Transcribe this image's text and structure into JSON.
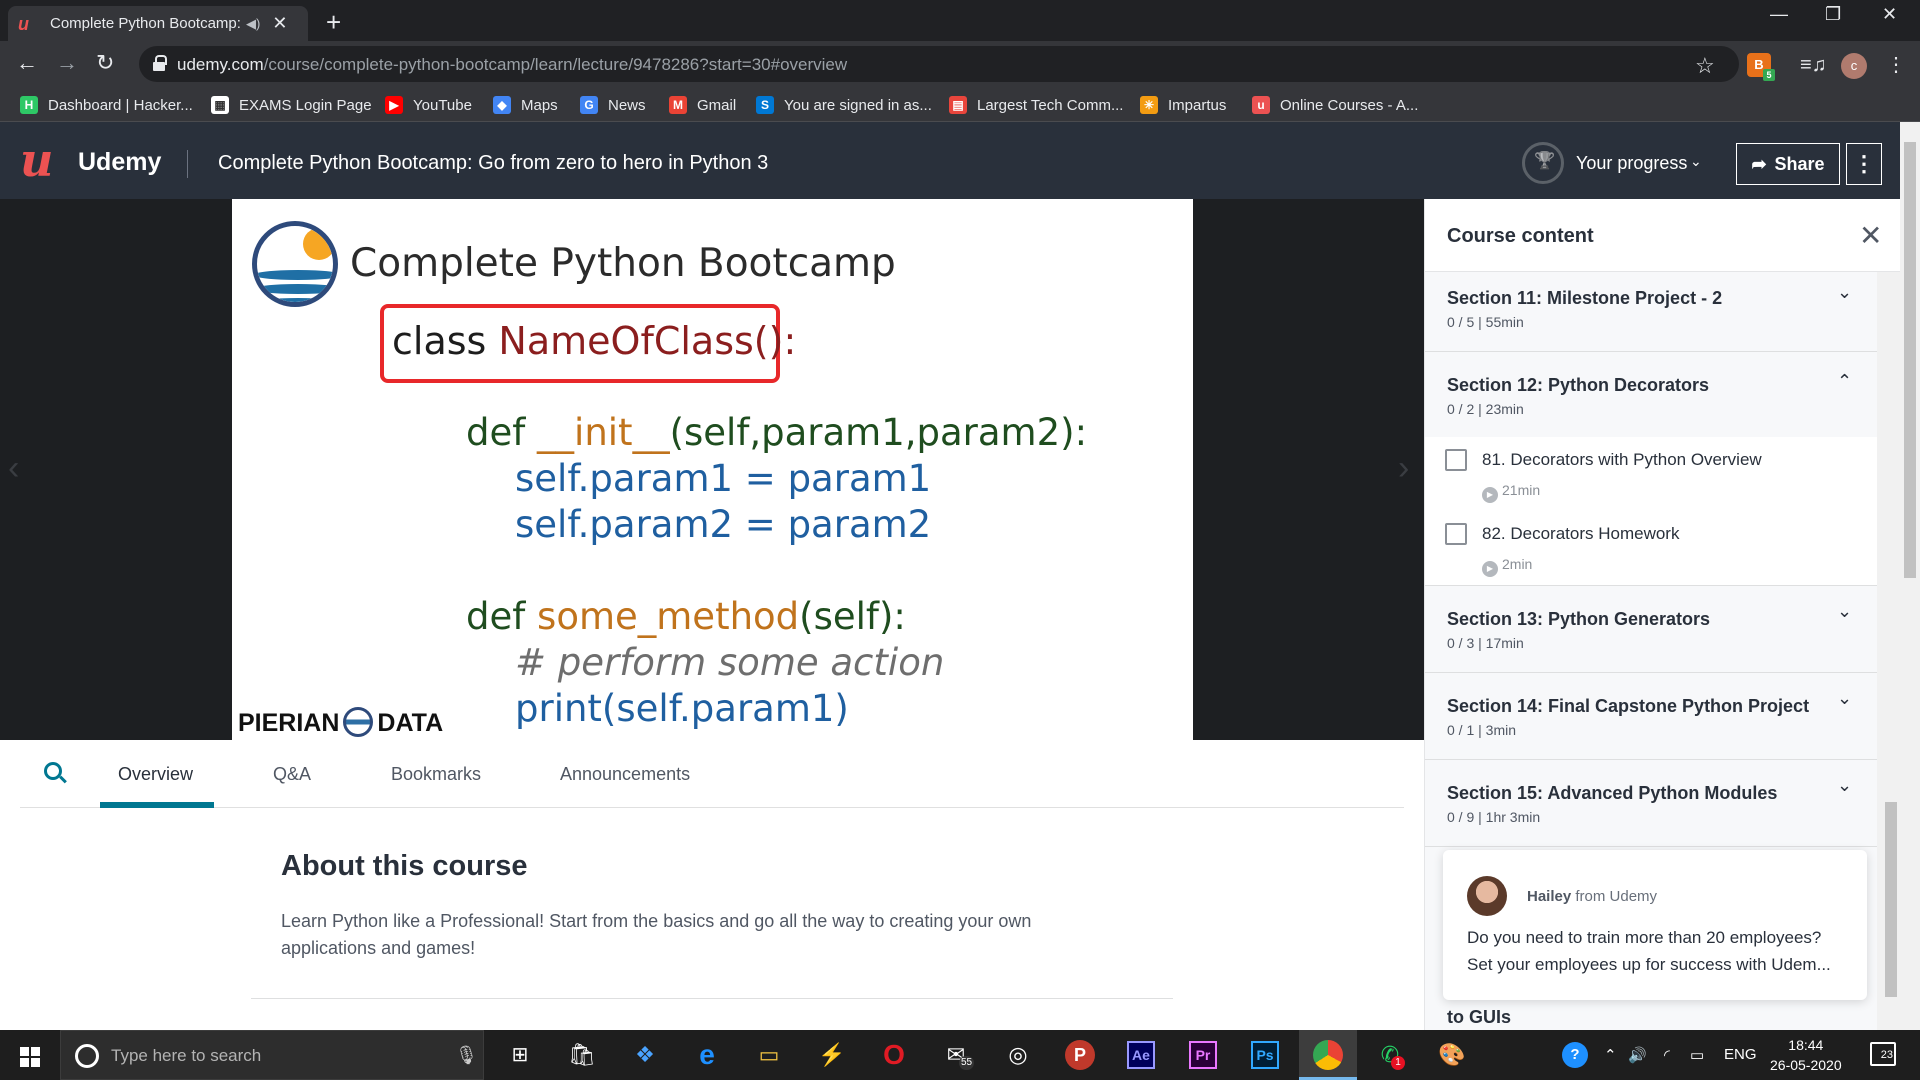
{
  "browser": {
    "tab_title": "Complete Python Bootcamp: Go from zero to hero in Python 3",
    "url_host": "udemy.com",
    "url_path": "/course/complete-python-bootcamp/learn/lecture/9478286?start=30#overview",
    "profile_initial": "c",
    "extension_badge": "5",
    "bookmarks": [
      {
        "label": "Dashboard | Hacker...",
        "icon": "hackerrank-icon",
        "color": "#2ec866",
        "glyph": "H"
      },
      {
        "label": "EXAMS Login Page",
        "icon": "exams-icon",
        "color": "#ffffff",
        "glyph": "▦"
      },
      {
        "label": "YouTube",
        "icon": "youtube-icon",
        "color": "#ff0000",
        "glyph": "▶"
      },
      {
        "label": "Maps",
        "icon": "maps-icon",
        "color": "#4285f4",
        "glyph": "◆"
      },
      {
        "label": "News",
        "icon": "news-icon",
        "color": "#4285f4",
        "glyph": "G"
      },
      {
        "label": "Gmail",
        "icon": "gmail-icon",
        "color": "#ea4335",
        "glyph": "M"
      },
      {
        "label": "You are signed in as...",
        "icon": "signin-icon",
        "color": "#0078d4",
        "glyph": "S"
      },
      {
        "label": "Largest Tech Comm...",
        "icon": "tech-community-icon",
        "color": "#e8453c",
        "glyph": "▤"
      },
      {
        "label": "Impartus",
        "icon": "impartus-icon",
        "color": "#f39c12",
        "glyph": "✳"
      },
      {
        "label": "Online Courses - A...",
        "icon": "udemy-icon",
        "color": "#ec5252",
        "glyph": "u"
      }
    ]
  },
  "header": {
    "logo_text": "Udemy",
    "course_title": "Complete Python Bootcamp: Go from zero to hero in Python 3",
    "progress_label": "Your progress",
    "share_label": "Share"
  },
  "slide": {
    "title": "Complete Python Bootcamp",
    "class_line": "class NameOfClass():",
    "code": {
      "def1_kw": "def ",
      "def1_fn": "__init__",
      "def1_args": "(self,param1,param2):",
      "line2": "self.param1 = param1",
      "line3": "self.param2 = param2",
      "def2_kw": "def ",
      "def2_fn": "some_method",
      "def2_args": "(self):",
      "comment": "# perform some action",
      "print_line": "print(self.param1)"
    },
    "brand_left": "PIERIAN",
    "brand_right": "DATA"
  },
  "content_tabs": {
    "items": [
      "Overview",
      "Q&A",
      "Bookmarks",
      "Announcements"
    ],
    "active": "Overview"
  },
  "about": {
    "title": "About this course",
    "description": "Learn Python like a Professional! Start from the basics and go all the way to creating your own applications and games!"
  },
  "sidebar": {
    "title": "Course content",
    "sections": [
      {
        "title": "Section 11: Milestone Project - 2",
        "meta": "0 / 5 | 55min",
        "expanded": false
      },
      {
        "title": "Section 12: Python Decorators",
        "meta": "0 / 2 | 23min",
        "expanded": true,
        "lectures": [
          {
            "title": "81. Decorators with Python Overview",
            "duration": "21min"
          },
          {
            "title": "82. Decorators Homework",
            "duration": "2min"
          }
        ]
      },
      {
        "title": "Section 13: Python Generators",
        "meta": "0 / 3 | 17min",
        "expanded": false
      },
      {
        "title": "Section 14: Final Capstone Python Project",
        "meta": "0 / 1 | 3min",
        "expanded": false
      },
      {
        "title": "Section 15: Advanced Python Modules",
        "meta": "0 / 9 | 1hr 3min",
        "expanded": false
      }
    ],
    "peek_text": "to GUIs"
  },
  "chat": {
    "sender": "Hailey",
    "from_text": "from Udemy",
    "message": "Do you need to train more than 20 employees? Set your employees up for success with Udem..."
  },
  "taskbar": {
    "search_placeholder": "Type here to search",
    "mail_badge": "55",
    "whatsapp_badge": "1",
    "language": "ENG",
    "time": "18:44",
    "date": "26-05-2020",
    "notification_count": "23"
  },
  "colors": {
    "udemy_red": "#ec5252",
    "udemy_header": "#29303b",
    "tab_accent": "#007791",
    "chrome_dark": "#202124"
  }
}
